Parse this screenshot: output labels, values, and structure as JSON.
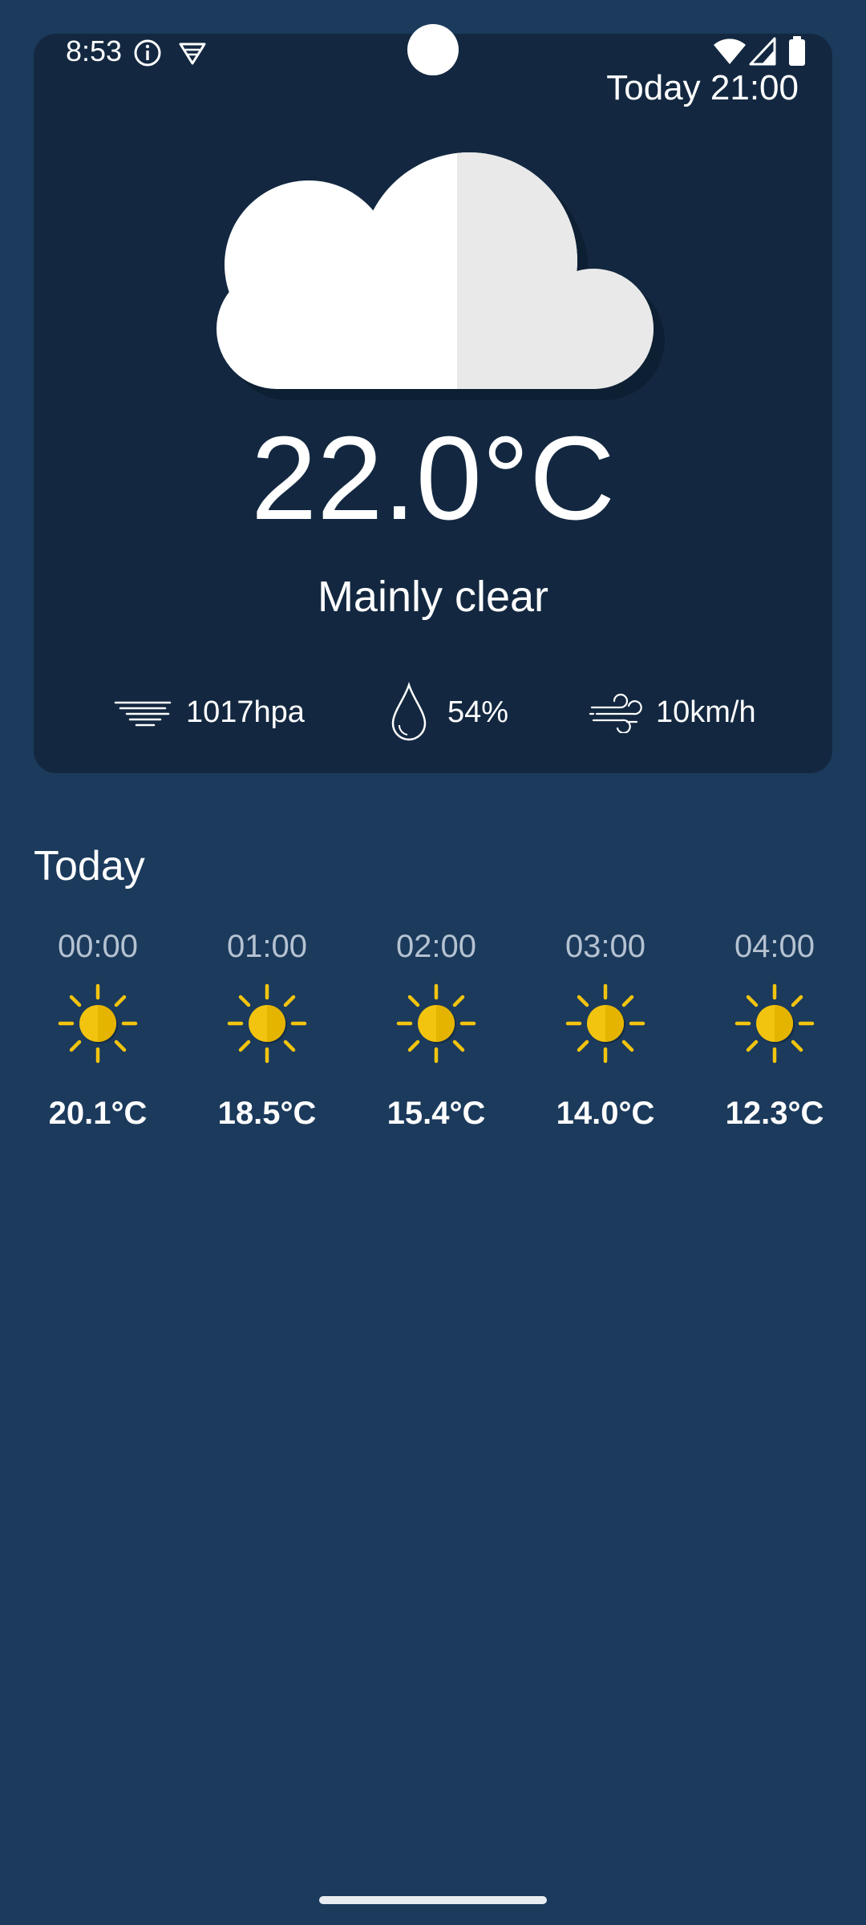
{
  "status_bar": {
    "time": "8:53",
    "left_icons": [
      "info-icon",
      "vpn-shield-icon"
    ],
    "right_icons": [
      "wifi-icon",
      "cellular-signal-icon",
      "battery-icon"
    ]
  },
  "current": {
    "updated": "Today 21:00",
    "icon": "cloud-icon",
    "temperature": "22.0°C",
    "condition": "Mainly clear",
    "pressure": "1017hpa",
    "humidity": "54%",
    "wind": "10km/h"
  },
  "today": {
    "title": "Today",
    "hours": [
      {
        "time": "00:00",
        "temp": "20.1°C",
        "icon": "sun-icon"
      },
      {
        "time": "01:00",
        "temp": "18.5°C",
        "icon": "sun-icon"
      },
      {
        "time": "02:00",
        "temp": "15.4°C",
        "icon": "sun-icon"
      },
      {
        "time": "03:00",
        "temp": "14.0°C",
        "icon": "sun-icon"
      },
      {
        "time": "04:00",
        "temp": "12.3°C",
        "icon": "sun-icon"
      }
    ]
  },
  "colors": {
    "background": "#1b3a5c",
    "card": "#132840",
    "sun": "#f2c40f",
    "text": "#ffffff",
    "muted_text": "#b5c2d1"
  }
}
